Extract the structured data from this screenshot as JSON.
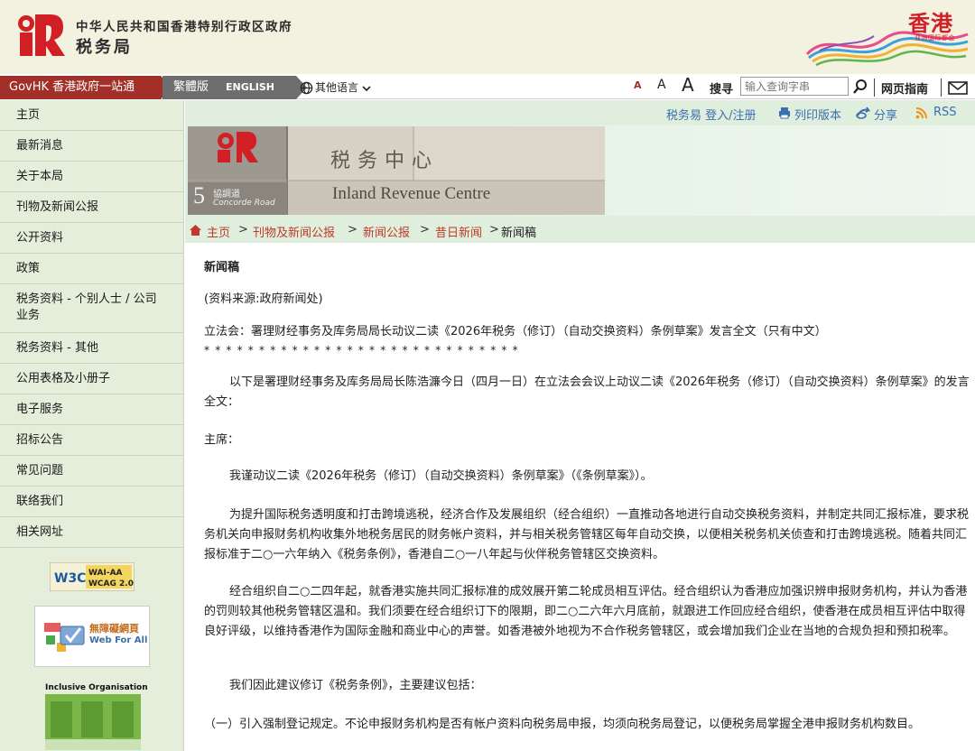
{
  "header": {
    "gov_name": "中华人民共和国香港特别行政区政府",
    "dept_name": "税务局",
    "brand_cn": "香港",
    "brand_sub": "亚洲国际都会",
    "colors": {
      "brand_red": "#d21f26",
      "govhk_red": "#a23028",
      "nav_green": "#e4eedb"
    }
  },
  "topbar": {
    "govhk": "GovHK 香港政府一站通",
    "lang_trad": "繁體版",
    "lang_en": "ENGLISH",
    "lang_other": "其他语言",
    "font_small": "A",
    "font_medium": "A",
    "font_large": "A",
    "search_label": "搜寻",
    "search_placeholder": "输入查询字串",
    "guide": "网页指南",
    "icons": [
      "globe-icon",
      "chevron-down-icon",
      "search-icon",
      "mail-icon"
    ]
  },
  "sidebar": {
    "items": [
      "主页",
      "最新消息",
      "关于本局",
      "刊物及新闻公报",
      "公开资料",
      "政策",
      "税务资料 - 个别人士 / 公司业务",
      "税务资料 - 其他",
      "公用表格及小册子",
      "电子服务",
      "招标公告",
      "常见问题",
      "联络我们",
      "相关网址"
    ],
    "badge_w3c": "W3C WAI-AA WCAG 2.0",
    "badge_web4all_cn": "無障礙網頁",
    "badge_web4all_en": "Web For All",
    "badge_io": "Inclusive Organisation"
  },
  "utility": {
    "etax": "税务易 登入/注册",
    "print": "列印版本",
    "share": "分享",
    "rss": "RSS"
  },
  "banner": {
    "building_cn": "税务中心",
    "building_en": "Inland Revenue Centre",
    "address_no": "5",
    "address_cn": "協調道",
    "address_en": "Concorde Road"
  },
  "breadcrumb": {
    "home": "主页",
    "l1": "刊物及新闻公报",
    "l2": "新闻公报",
    "l3": "昔日新闻",
    "current": "新闻稿",
    "sep": ">"
  },
  "article": {
    "title": "新闻稿",
    "source": "(资料来源:政府新闻处)",
    "headline": "立法会：署理财经事务及库务局局长动议二读《2026年税务（修订）（自动交换资料）条例草案》发言全文（只有中文）",
    "stars": "*****************************",
    "p1": "以下是署理财经事务及库务局局长陈浩濂今日（四月一日）在立法会会议上动议二读《2026年税务（修订）（自动交换资料）条例草案》的发言全文：",
    "chair": "主席：",
    "p2": "我谨动议二读《2026年税务（修订）（自动交换资料）条例草案》（《条例草案》）。",
    "p3": "为提升国际税务透明度和打击跨境逃税，经济合作及发展组织（经合组织）一直推动各地进行自动交换税务资料，并制定共同汇报标准，要求税务机关向申报财务机构收集外地税务居民的财务帐户资料，并与相关税务管辖区每年自动交换，以便相关税务机关侦查和打击跨境逃税。随着共同汇报标准于二○一六年纳入《税务条例》，香港自二○一八年起与伙伴税务管辖区交换资料。",
    "p4": "经合组织自二○二四年起，就香港实施共同汇报标准的成效展开第二轮成员相互评估。经合组织认为香港应加强识辨申报财务机构，并认为香港的罚则较其他税务管辖区温和。我们须要在经合组织订下的限期，即二○二六年六月底前，就跟进工作回应经合组织，使香港在成员相互评估中取得良好评级，以维持香港作为国际金融和商业中心的声誉。如香港被外地视为不合作税务管辖区，或会增加我们企业在当地的合规负担和预扣税率。",
    "p5": "我们因此建议修订《税务条例》，主要建议包括：",
    "p6": "（一）引入强制登记规定。不论申报财务机构是否有帐户资料向税务局申报，均须向税务局登记，以便税务局掌握全港申报财务机构数目。"
  }
}
